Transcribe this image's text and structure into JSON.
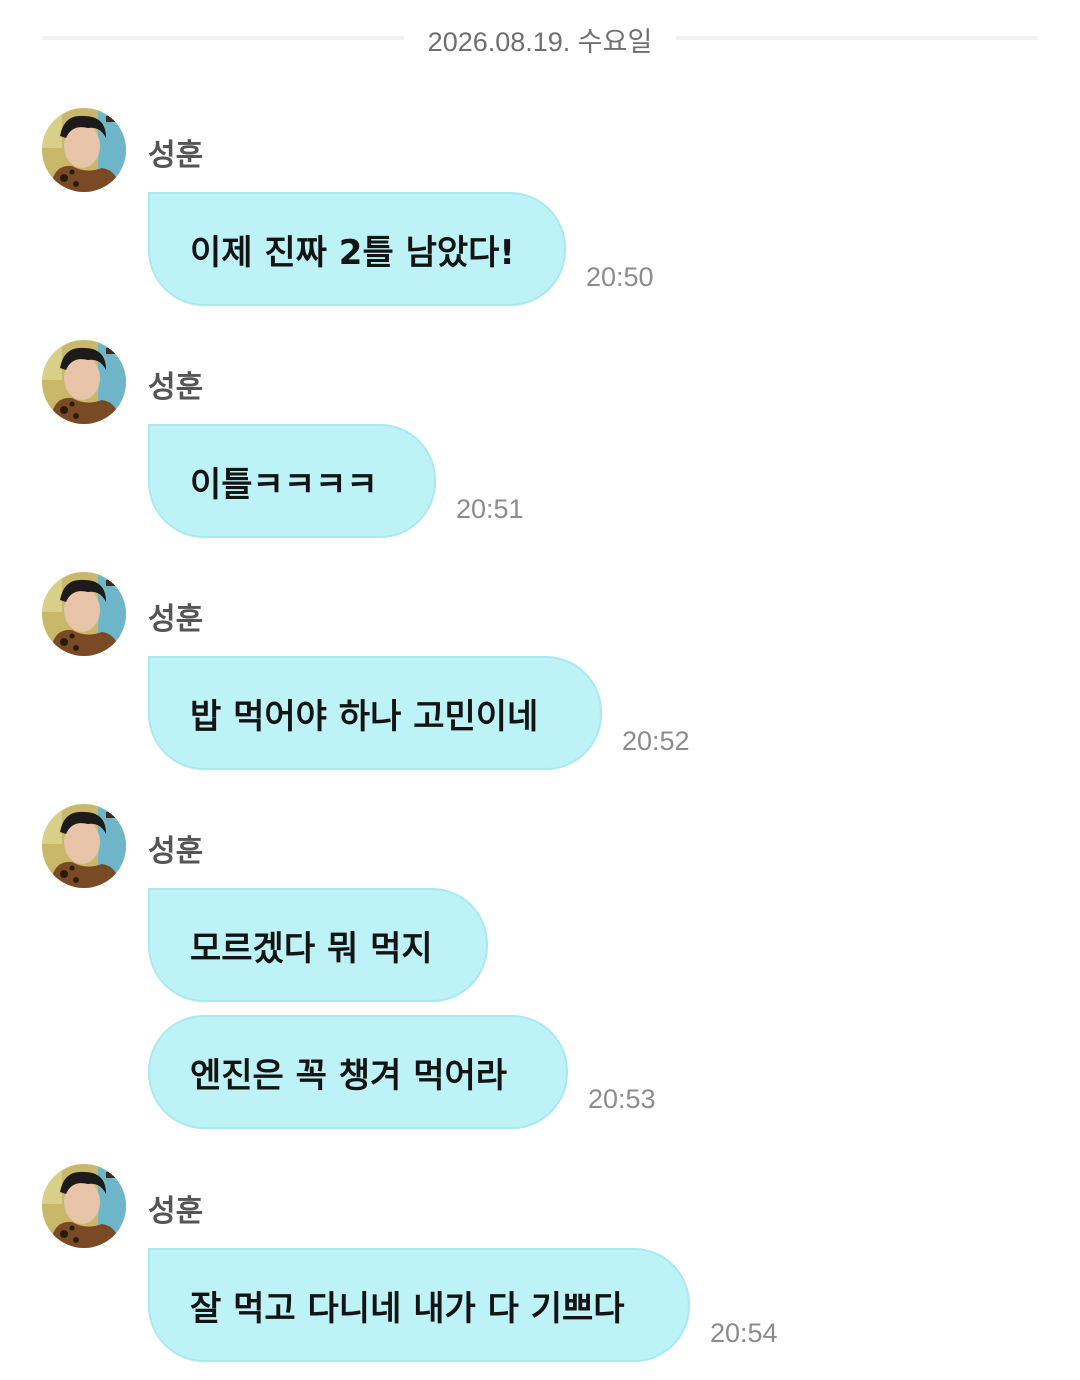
{
  "chat": {
    "date_separator": "2026.08.19. 수요일",
    "messages": [
      {
        "sender": "성훈",
        "text": "이제 진짜 2틀 남았다!",
        "time": "20:50"
      },
      {
        "sender": "성훈",
        "text": "이틀ㅋㅋㅋㅋ",
        "time": "20:51"
      },
      {
        "sender": "성훈",
        "text": "밥 먹어야 하나 고민이네",
        "time": "20:52"
      },
      {
        "sender": "성훈",
        "text": "모르겠다 뭐 먹지",
        "continuation": "엔진은 꼭 챙겨 먹어라",
        "time": "20:53"
      },
      {
        "sender": "성훈",
        "text": "잘 먹고 다니네 내가 다 기쁘다",
        "time": "20:54"
      }
    ]
  },
  "colors": {
    "bubble": "#bdf2f6",
    "bubble_border": "#a9e9ef",
    "time": "#8c8c8c",
    "sender": "#555555"
  },
  "icons": {
    "avatar": "profile-photo-avatar"
  }
}
